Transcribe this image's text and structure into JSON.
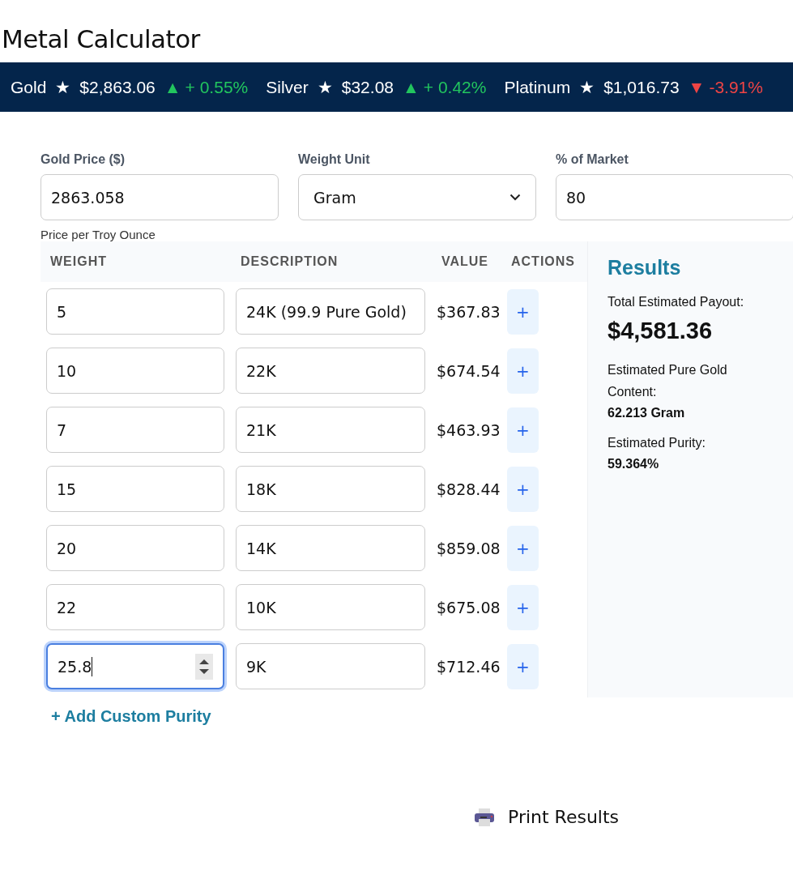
{
  "title": "Metal Calculator",
  "ticker": [
    {
      "name": "Gold",
      "star": "★",
      "price": "$2,863.06",
      "arrow": "▲",
      "change": "+ 0.55%",
      "rising": true
    },
    {
      "name": "Silver",
      "star": "★",
      "price": "$32.08",
      "arrow": "▲",
      "change": "+ 0.42%",
      "rising": true
    },
    {
      "name": "Platinum",
      "star": "★",
      "price": "$1,016.73",
      "arrow": "▼",
      "change": "-3.91%",
      "rising": false
    }
  ],
  "form": {
    "gold_price": {
      "label": "Gold Price ($)",
      "value": "2863.058",
      "hint": "Price per Troy Ounce"
    },
    "weight_unit": {
      "label": "Weight Unit",
      "value": "Gram"
    },
    "market": {
      "label": "% of Market",
      "value": "80"
    }
  },
  "table": {
    "columns": [
      "WEIGHT",
      "DESCRIPTION",
      "VALUE",
      "ACTIONS"
    ],
    "rows": [
      {
        "weight": "5",
        "description": "24K (99.9 Pure Gold)",
        "value": "$367.83",
        "action": "+",
        "focused": false
      },
      {
        "weight": "10",
        "description": "22K",
        "value": "$674.54",
        "action": "+",
        "focused": false
      },
      {
        "weight": "7",
        "description": "21K",
        "value": "$463.93",
        "action": "+",
        "focused": false
      },
      {
        "weight": "15",
        "description": "18K",
        "value": "$828.44",
        "action": "+",
        "focused": false
      },
      {
        "weight": "20",
        "description": "14K",
        "value": "$859.08",
        "action": "+",
        "focused": false
      },
      {
        "weight": "22",
        "description": "10K",
        "value": "$675.08",
        "action": "+",
        "focused": false
      },
      {
        "weight": "25.8",
        "description": "9K",
        "value": "$712.46",
        "action": "+",
        "focused": true
      }
    ]
  },
  "add_link": "+ Add Custom Purity",
  "results": {
    "title": "Results",
    "payout_label": "Total Estimated Payout:",
    "payout": "$4,581.36",
    "content_label": "Estimated Pure Gold Content:",
    "content": "62.213 Gram",
    "purity_label": "Estimated Purity:",
    "purity": "59.364%"
  },
  "print_button": "Print Results"
}
